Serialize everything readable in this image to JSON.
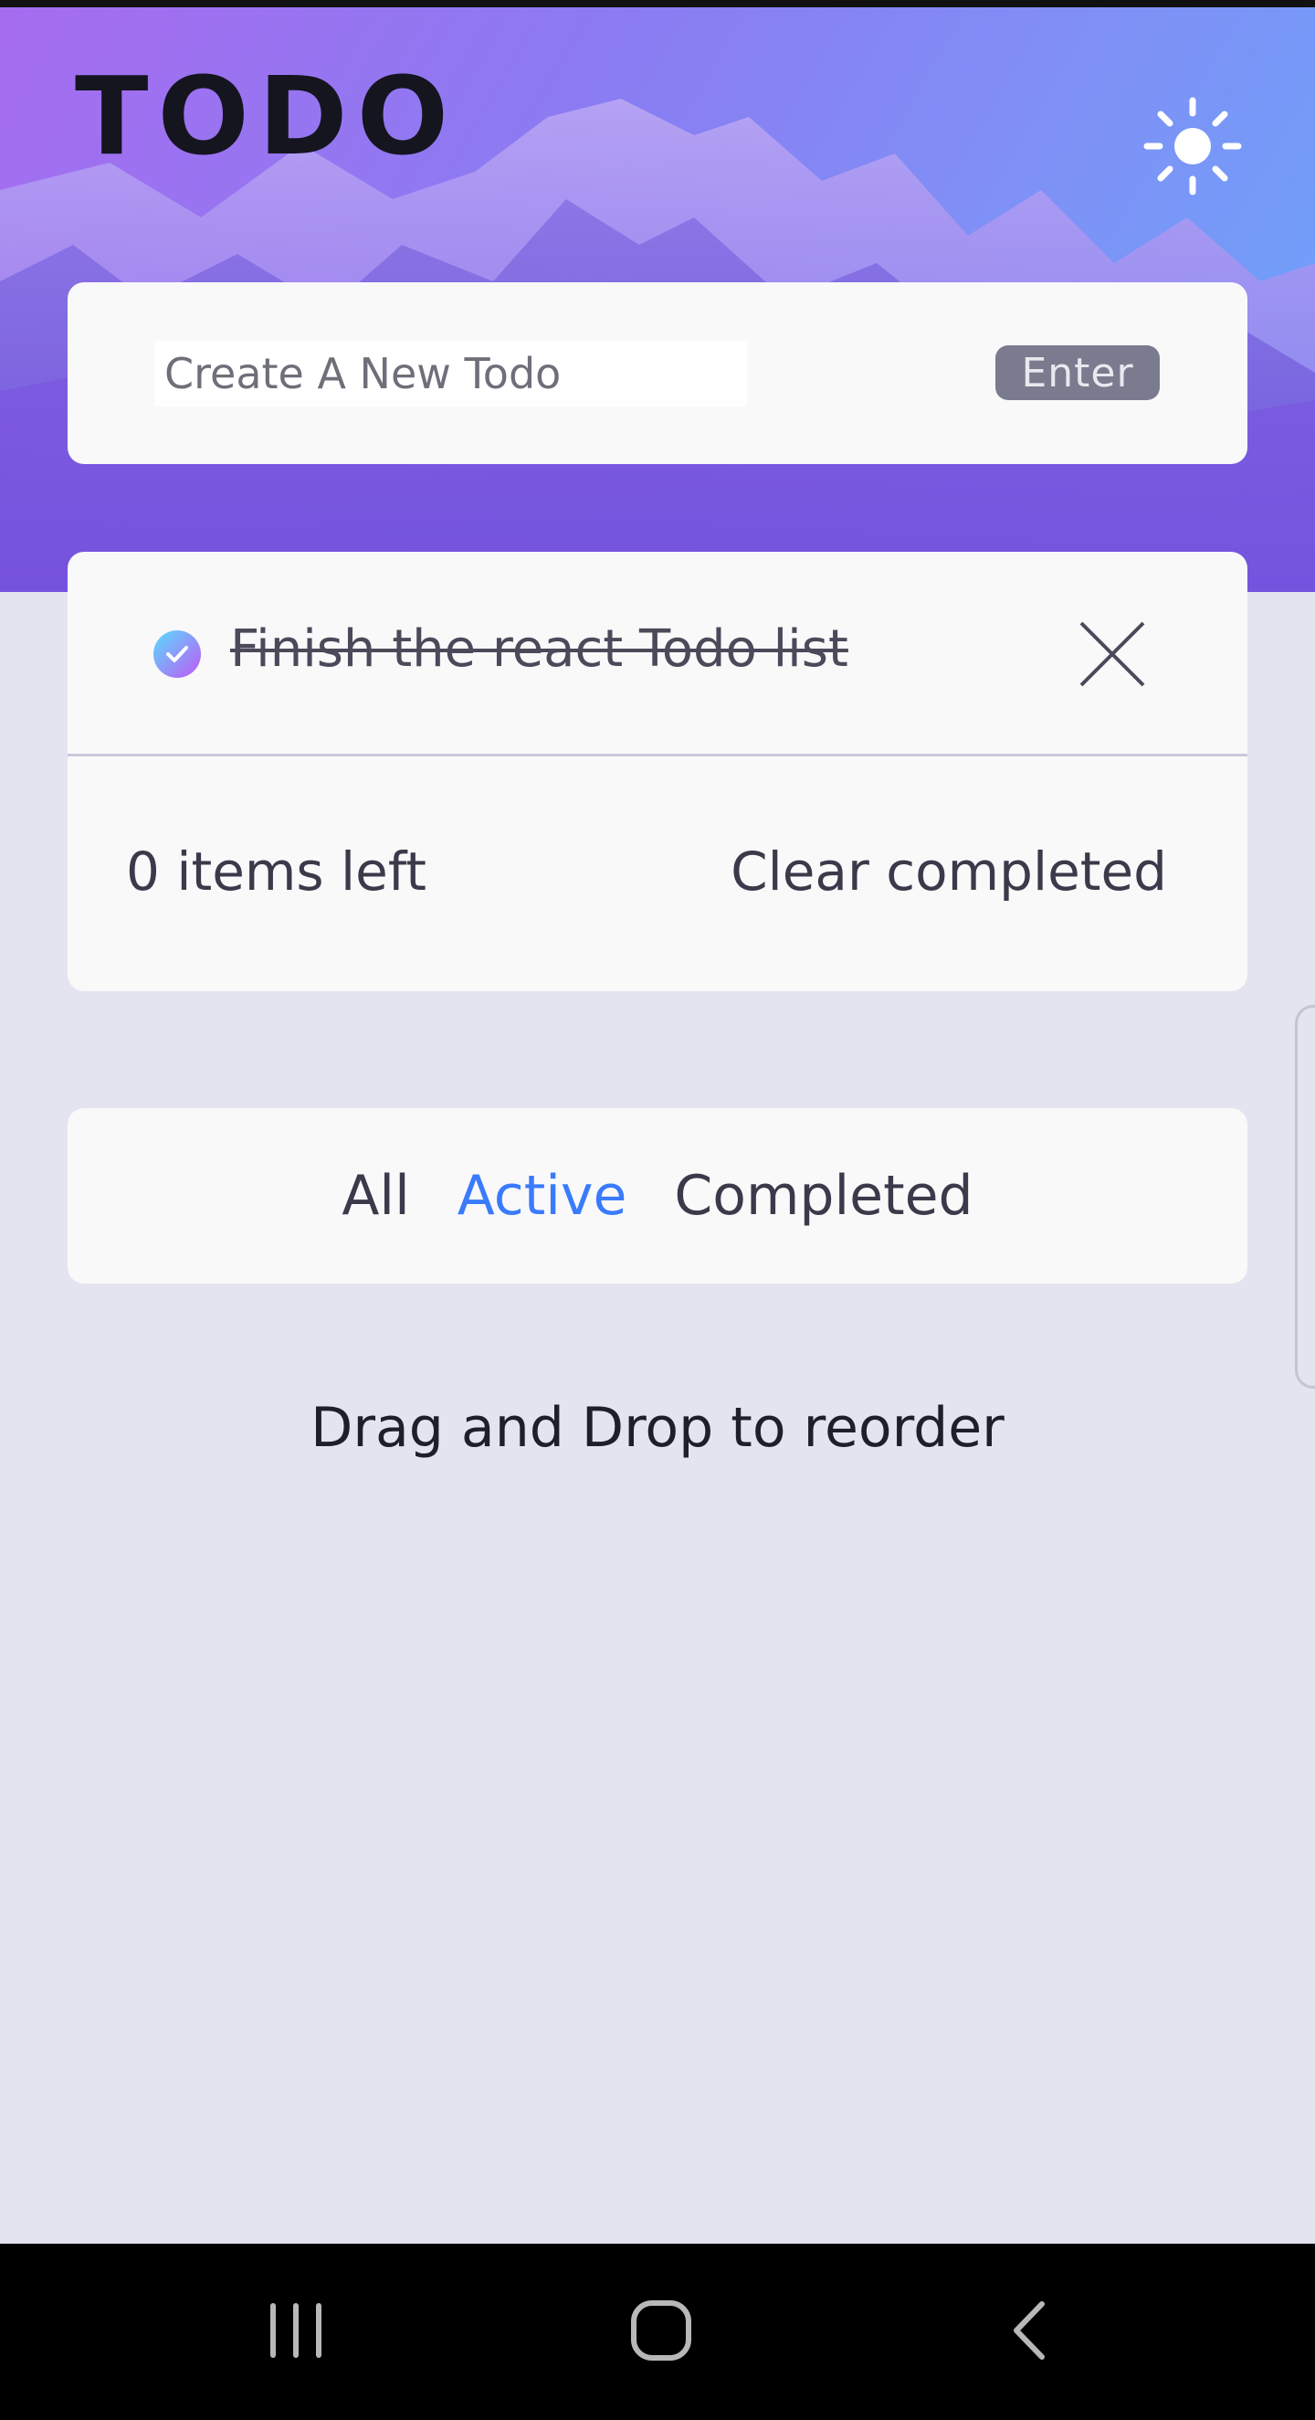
{
  "header": {
    "title": "TODO",
    "theme_icon": "sun-icon"
  },
  "new_todo": {
    "placeholder": "Create A New Todo",
    "value": "",
    "enter_label": "Enter"
  },
  "todos": [
    {
      "text": "Finish the react Todo list",
      "completed": true
    }
  ],
  "footer": {
    "items_left": "0 items left",
    "clear_label": "Clear completed"
  },
  "filters": {
    "all": "All",
    "active": "Active",
    "completed": "Completed",
    "selected": "Active"
  },
  "hint": "Drag and Drop to reorder",
  "colors": {
    "accent": "#3a7bfd",
    "background": "#e4e4f1",
    "card": "#f9f9fa",
    "check_gradient_start": "#57ddff",
    "check_gradient_end": "#c058f3"
  },
  "system_nav": {
    "recents": "recents-icon",
    "home": "home-icon",
    "back": "back-icon"
  }
}
